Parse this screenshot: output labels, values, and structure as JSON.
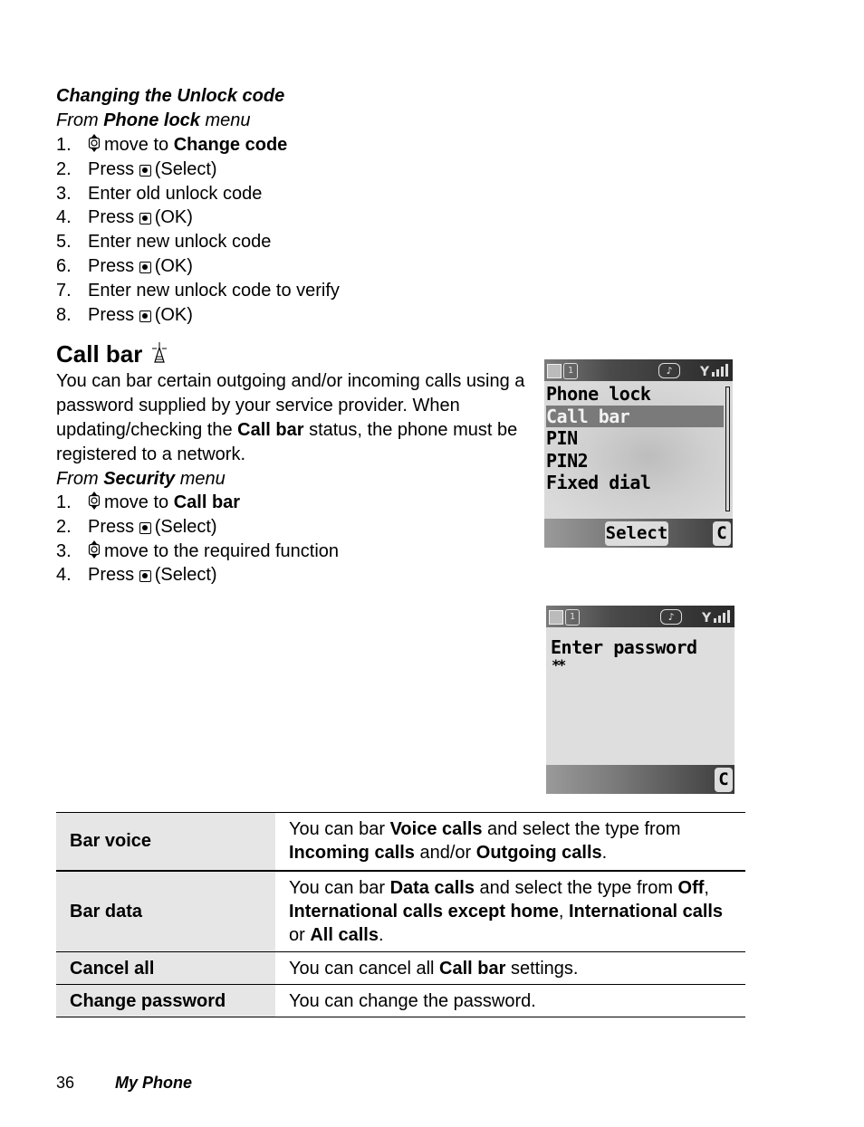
{
  "section1": {
    "title": "Changing the Unlock code",
    "from": {
      "prefix": "From ",
      "menu": "Phone lock",
      "suffix": " menu"
    },
    "steps": [
      {
        "num": "1.",
        "icon": "nav-key-icon",
        "text": "move to ",
        "bold": "Change code",
        "after": ""
      },
      {
        "num": "2.",
        "icon": "select-key-icon",
        "text": "Press ",
        "after": " (Select)"
      },
      {
        "num": "3.",
        "text": "Enter old unlock code"
      },
      {
        "num": "4.",
        "icon": "select-key-icon",
        "text": "Press ",
        "after": " (OK)"
      },
      {
        "num": "5.",
        "text": "Enter new unlock code"
      },
      {
        "num": "6.",
        "icon": "select-key-icon",
        "text": "Press ",
        "after": " (OK)"
      },
      {
        "num": "7.",
        "text": "Enter new unlock code to verify"
      },
      {
        "num": "8.",
        "icon": "select-key-icon",
        "text": "Press ",
        "after": " (OK)"
      }
    ]
  },
  "section2": {
    "heading": "Call bar",
    "heading_icon": "antenna-icon",
    "para": {
      "t1": "You can bar certain outgoing and/or incoming calls using a password supplied by your service provider. When updating/checking the ",
      "b1": "Call bar",
      "t2": " status, the phone must be registered to a network."
    },
    "from": {
      "prefix": "From ",
      "menu": "Security",
      "suffix": " menu"
    },
    "steps": [
      {
        "num": "1.",
        "text": "move to ",
        "bold": "Call bar"
      },
      {
        "num": "2.",
        "text": "Press ",
        "after": " (Select)"
      },
      {
        "num": "3.",
        "text": "move to the required function"
      },
      {
        "num": "4.",
        "text": "Press ",
        "after": " (Select)"
      }
    ]
  },
  "screen1": {
    "items": [
      "Phone lock",
      "Call bar",
      "PIN",
      "PIN2",
      "Fixed dial"
    ],
    "highlighted": "Call bar",
    "softkey_center": "Select",
    "softkey_right": "C"
  },
  "screen2": {
    "prompt": "Enter password",
    "masked_value": "**",
    "softkey_right": "C"
  },
  "table": {
    "rows": [
      {
        "key": "Bar voice",
        "parts": [
          [
            "You can bar ",
            false
          ],
          [
            "Voice calls",
            true
          ],
          [
            " and select the type from ",
            false
          ],
          [
            "Incoming calls",
            true
          ],
          [
            " and/or ",
            false
          ],
          [
            "Outgoing calls",
            true
          ],
          [
            ".",
            false
          ]
        ]
      },
      {
        "key": "Bar data",
        "parts": [
          [
            "You can bar ",
            false
          ],
          [
            "Data calls",
            true
          ],
          [
            " and select the type from ",
            false
          ],
          [
            "Off",
            true
          ],
          [
            ", ",
            false
          ],
          [
            "International calls except home",
            true
          ],
          [
            ", ",
            false
          ],
          [
            "International calls",
            true
          ],
          [
            " or ",
            false
          ],
          [
            "All calls",
            true
          ],
          [
            ".",
            false
          ]
        ]
      },
      {
        "key": "Cancel all",
        "parts": [
          [
            "You can cancel all ",
            false
          ],
          [
            "Call bar",
            true
          ],
          [
            " settings.",
            false
          ]
        ]
      },
      {
        "key": "Change password",
        "parts": [
          [
            "You can change the password.",
            false
          ]
        ]
      }
    ]
  },
  "footer": {
    "page": "36",
    "title": "My Phone"
  }
}
